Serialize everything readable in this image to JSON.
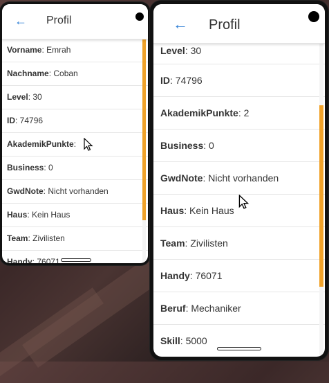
{
  "back_icon": "arrow-left-icon",
  "left_phone": {
    "title": "Profil",
    "rows": [
      {
        "label": "Vorname",
        "value": ": Emrah"
      },
      {
        "label": "Nachname",
        "value": ": Coban"
      },
      {
        "label": "Level",
        "value": ": 30"
      },
      {
        "label": "ID",
        "value": ": 74796"
      },
      {
        "label": "AkademikPunkte",
        "value": ":"
      },
      {
        "label": "Business",
        "value": ": 0"
      },
      {
        "label": "GwdNote",
        "value": ": Nicht vorhanden"
      },
      {
        "label": "Haus",
        "value": ": Kein Haus"
      },
      {
        "label": "Team",
        "value": ": Zivilisten"
      },
      {
        "label": "Handy",
        "value": ": 76071"
      }
    ]
  },
  "right_phone": {
    "title": "Profil",
    "rows": [
      {
        "label": "Level",
        "value": ": 30"
      },
      {
        "label": "ID",
        "value": ": 74796"
      },
      {
        "label": "AkademikPunkte",
        "value": ": 2"
      },
      {
        "label": "Business",
        "value": ": 0"
      },
      {
        "label": "GwdNote",
        "value": ": Nicht vorhanden"
      },
      {
        "label": "Haus",
        "value": ": Kein Haus"
      },
      {
        "label": "Team",
        "value": ": Zivilisten"
      },
      {
        "label": "Handy",
        "value": ": 76071"
      },
      {
        "label": "Beruf",
        "value": ": Mechaniker"
      },
      {
        "label": "Skill",
        "value": ": 5000"
      }
    ]
  },
  "colors": {
    "accent": "#2f7fd6",
    "scroll_thumb": "#f0a22a"
  }
}
